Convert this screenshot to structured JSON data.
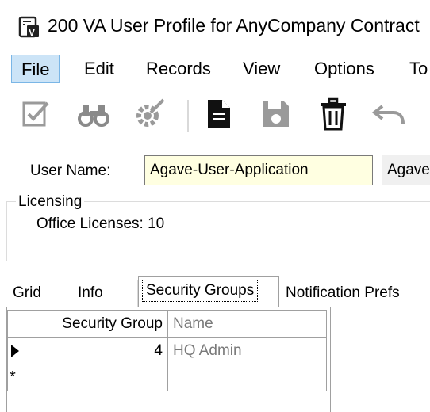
{
  "window": {
    "title": "200 VA User Profile for AnyCompany Contract"
  },
  "menu": {
    "items": [
      {
        "label": "File",
        "active": true
      },
      {
        "label": "Edit",
        "active": false
      },
      {
        "label": "Records",
        "active": false
      },
      {
        "label": "View",
        "active": false
      },
      {
        "label": "Options",
        "active": false
      },
      {
        "label": "To",
        "active": false
      }
    ]
  },
  "toolbar": {
    "icons": [
      "checklist-icon",
      "binoculars-icon",
      "edit-gear-icon",
      "new-document-icon",
      "save-icon",
      "delete-icon",
      "undo-icon"
    ]
  },
  "form": {
    "username_label": "User Name:",
    "username_value": "Agave-User-Application",
    "second_field_value": "Agave",
    "licensing_legend": "Licensing",
    "office_licenses_text": "Office Licenses: 10"
  },
  "tabs": [
    {
      "label": "Grid",
      "selected": false
    },
    {
      "label": "Info",
      "selected": false
    },
    {
      "label": "Security Groups",
      "selected": true
    },
    {
      "label": "Notification Prefs",
      "selected": false
    }
  ],
  "grid": {
    "columns": [
      "Security Group",
      "Name"
    ],
    "rows": [
      {
        "security_group": "4",
        "name": "HQ Admin",
        "current": true
      }
    ],
    "new_row_marker": "*"
  },
  "colors": {
    "active_menu_bg": "#cce4f7",
    "input_bg": "#ffffe1",
    "disabled_text": "#7a7a7a"
  }
}
